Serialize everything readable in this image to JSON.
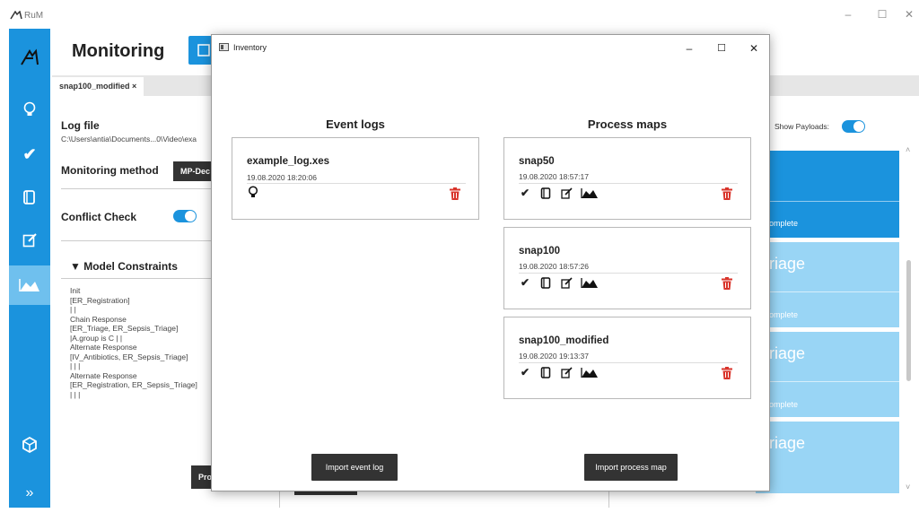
{
  "app": {
    "title": "RuM"
  },
  "main": {
    "page_title": "Monitoring",
    "tab_label": "snap100_modified ×",
    "log_file_label": "Log file",
    "log_file_path": "C:\\Users\\antia\\Documents...0\\Video\\exa",
    "monitoring_method_label": "Monitoring method",
    "monitoring_method_value": "MP-Dec",
    "conflict_check_label": "Conflict Check",
    "model_constraints_label": "▼ Model Constraints",
    "constraints": [
      "Init",
      "[ER_Registration]",
      "| |",
      "Chain Response",
      "[ER_Triage, ER_Sepsis_Triage]",
      "|A.group is C | |",
      "Alternate Response",
      "[IV_Antibiotics, ER_Sepsis_Triage]",
      "| | |",
      "Alternate Response",
      "[ER_Registration, ER_Sepsis_Triage]",
      "| | |"
    ],
    "pro_button": "Pro",
    "show_payloads_label": "Show Payloads:",
    "right_cards": [
      {
        "title": "",
        "status": "omplete"
      },
      {
        "title": "riage",
        "status": "omplete"
      },
      {
        "title": "riage",
        "status": "omplete"
      },
      {
        "title": "riage",
        "status": ""
      }
    ]
  },
  "dialog": {
    "title": "Inventory",
    "event_logs_title": "Event logs",
    "process_maps_title": "Process maps",
    "event_logs": [
      {
        "name": "example_log.xes",
        "date": "19.08.2020 18:20:06"
      }
    ],
    "process_maps": [
      {
        "name": "snap50",
        "date": "19.08.2020 18:57:17"
      },
      {
        "name": "snap100",
        "date": "19.08.2020 18:57:26"
      },
      {
        "name": "snap100_modified",
        "date": "19.08.2020 19:13:37"
      }
    ],
    "import_event_log": "Import event log",
    "import_process_map": "Import process map"
  },
  "colors": {
    "accent": "#1b93dd",
    "accent_light": "#99d5f5",
    "delete": "#d9342b",
    "dark_button": "#333333"
  }
}
